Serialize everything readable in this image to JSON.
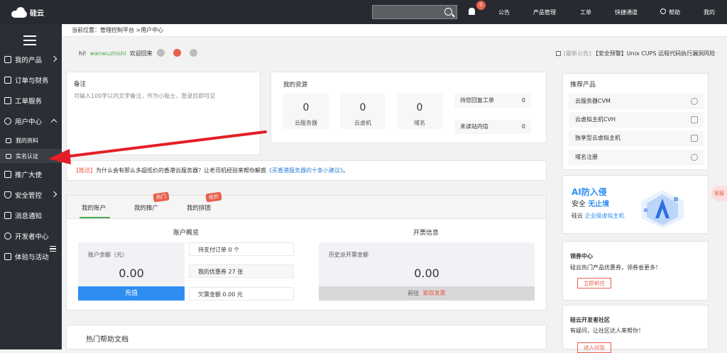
{
  "brand": {
    "name": "硅云"
  },
  "topbar": {
    "notification_count": "0",
    "nav": [
      "公告",
      "产品管理",
      "工单",
      "快捷通道",
      "帮助",
      "我的"
    ]
  },
  "sidebar": {
    "items": [
      {
        "label": "我的产品"
      },
      {
        "label": "订单与财务"
      },
      {
        "label": "工单服务"
      },
      {
        "label": "用户中心"
      },
      {
        "label": "推广大使"
      },
      {
        "label": "安全管控"
      },
      {
        "label": "消息通知"
      },
      {
        "label": "开发者中心"
      },
      {
        "label": "体验与活动"
      }
    ],
    "subitems": [
      {
        "label": "我的资料"
      },
      {
        "label": "实名认证"
      }
    ]
  },
  "breadcrumb": {
    "prefix": "当前位置：",
    "path": "管理控制平台",
    "current": ">用户中心"
  },
  "greeting": {
    "hi": "hi!",
    "user": "wanwuzhishi",
    "welcome": "欢迎回来"
  },
  "announcement": {
    "tag": "[最新公告]",
    "text": "【安全预警】Unix CUPS 远程代码执行漏洞风险"
  },
  "note": {
    "title": "备注",
    "placeholder": "可输入100字以内文字备注，作为小贴士，登录后即可见"
  },
  "resources": {
    "title": "我的资源",
    "boxes": [
      {
        "value": "0",
        "label": "云服务器"
      },
      {
        "value": "0",
        "label": "云虚机"
      },
      {
        "value": "0",
        "label": "域名"
      }
    ],
    "rows": [
      {
        "label": "待您回复工单",
        "value": "0"
      },
      {
        "label": "未读站内信",
        "value": "0"
      }
    ]
  },
  "notice": {
    "tag": "【推送】",
    "text": "为什么会有那么多超低价的香港云服务器？让老司机经验来帮你解惑",
    "link": "《买香港服务器的十条小建议》",
    "end": "。"
  },
  "tabs": [
    {
      "label": "我的账户",
      "badge": ""
    },
    {
      "label": "我的推广",
      "badge": "热门"
    },
    {
      "label": "我的拼团",
      "badge": "低价"
    }
  ],
  "account": {
    "title": "账户概览",
    "balance_label": "账户余额（元）",
    "balance": "0.00",
    "recharge": "充值",
    "rows": [
      "待支付订单 0 个",
      "我的优惠券 27 张",
      "欠票金额 0.00 元"
    ]
  },
  "invoice": {
    "title": "开票信息",
    "label": "历史总开票金额",
    "amount": "0.00",
    "goto": "前往",
    "link": "索取发票"
  },
  "help_docs": {
    "title": "热门帮助文档"
  },
  "recommend": {
    "title": "推荐产品",
    "items": [
      {
        "label": "云服务器CVM",
        "icon": "cloud-icon"
      },
      {
        "label": "云虚拟主机CVH",
        "icon": "server-icon"
      },
      {
        "label": "独享型云虚拟主机",
        "icon": "server-icon"
      },
      {
        "label": "域名注册",
        "icon": "globe-icon"
      }
    ]
  },
  "banner": {
    "line1": "AI防入侵",
    "line2a": "安全",
    "line2b": "无止境",
    "line3a": "硅云",
    "line3b": "企业级虚拟主机"
  },
  "coupon": {
    "title": "领券中心",
    "desc": "硅云热门产品优惠券，领券省更多！",
    "button": "立即前往"
  },
  "community": {
    "title": "硅云开发者社区",
    "desc": "有疑问，让社区达人来帮你！",
    "button": "进入问答"
  },
  "float_button": {
    "label": "客服"
  },
  "colors": {
    "topbar": "#272a30",
    "sidebar": "#2b2e35",
    "accent_green": "#4ca84c",
    "accent_blue": "#2e8ef0",
    "accent_red": "#e8604c",
    "annotation_arrow": "#e41e26"
  }
}
